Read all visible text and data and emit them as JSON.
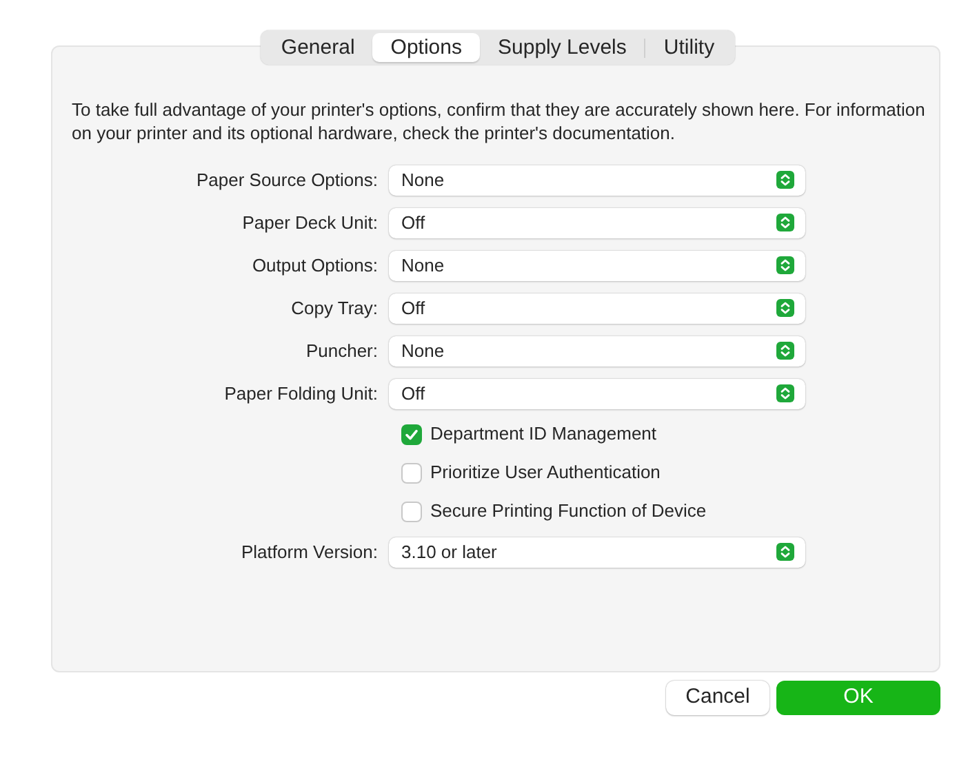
{
  "tabs": [
    {
      "label": "General",
      "selected": false
    },
    {
      "label": "Options",
      "selected": true
    },
    {
      "label": "Supply Levels",
      "selected": false
    },
    {
      "label": "Utility",
      "selected": false
    }
  ],
  "description": "To take full advantage of your printer's options, confirm that they are accurately shown here. For information on your printer and its optional hardware, check the printer's documentation.",
  "rows": [
    {
      "kind": "popup",
      "label": "Paper Source Options:",
      "value": "None"
    },
    {
      "kind": "popup",
      "label": "Paper Deck Unit:",
      "value": "Off"
    },
    {
      "kind": "popup",
      "label": "Output Options:",
      "value": "None"
    },
    {
      "kind": "popup",
      "label": "Copy Tray:",
      "value": "Off"
    },
    {
      "kind": "popup",
      "label": "Puncher:",
      "value": "None"
    },
    {
      "kind": "popup",
      "label": "Paper Folding Unit:",
      "value": "Off"
    },
    {
      "kind": "checkbox",
      "label": "Department ID Management",
      "checked": true
    },
    {
      "kind": "checkbox",
      "label": "Prioritize User Authentication",
      "checked": false
    },
    {
      "kind": "checkbox",
      "label": "Secure Printing Function of Device",
      "checked": false
    },
    {
      "kind": "popup",
      "label": "Platform Version:",
      "value": "3.10 or later"
    }
  ],
  "buttons": [
    {
      "label": "Cancel",
      "kind": "secondary"
    },
    {
      "label": "OK",
      "kind": "primary"
    }
  ]
}
